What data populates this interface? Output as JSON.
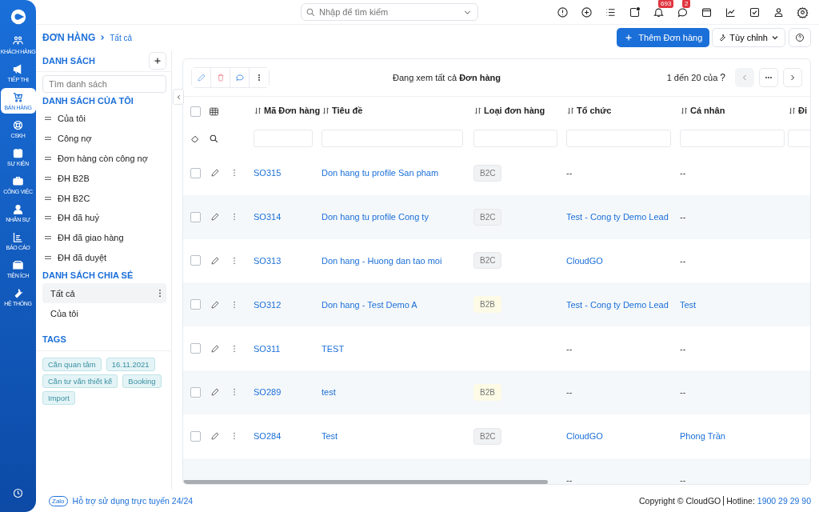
{
  "nav": [
    {
      "label": "KHÁCH HÀNG",
      "selected": false
    },
    {
      "label": "TIẾP THỊ",
      "selected": false
    },
    {
      "label": "BÁN HÀNG",
      "selected": true
    },
    {
      "label": "CSKH",
      "selected": false
    },
    {
      "label": "SỰ KIỆN",
      "selected": false
    },
    {
      "label": "CÔNG VIỆC",
      "selected": false
    },
    {
      "label": "NHÂN SỰ",
      "selected": false
    },
    {
      "label": "BÁO CÁO",
      "selected": false
    },
    {
      "label": "TIỆN ÍCH",
      "selected": false
    },
    {
      "label": "HỆ THỐNG",
      "selected": false
    }
  ],
  "search": {
    "placeholder": "Nhập để tìm kiếm"
  },
  "top_badges": {
    "notifications": "693",
    "messages": "2"
  },
  "breadcrumb": {
    "module": "ĐƠN HÀNG",
    "current": "Tất cả"
  },
  "header_buttons": {
    "add": "Thêm Đơn hàng",
    "customize": "Tùy chỉnh"
  },
  "sidebar": {
    "title": "DANH SÁCH",
    "search_placeholder": "Tìm danh sách",
    "my_lists_title": "DANH SÁCH CỦA TÔI",
    "my_lists": [
      "Của tôi",
      "Công nợ",
      "Đơn hàng còn công nợ",
      "ĐH B2B",
      "ĐH B2C",
      "ĐH đã huỷ",
      "ĐH đã giao hàng",
      "ĐH đã duyệt"
    ],
    "shared_title": "DANH SÁCH CHIA SẺ",
    "shared": [
      {
        "label": "Tất cả",
        "selected": true
      },
      {
        "label": "Của tôi",
        "selected": false
      }
    ],
    "tags_title": "TAGS",
    "tags": [
      "Cần quan tâm",
      "16.11.2021",
      "Cần tư vấn thiết kế",
      "Booking",
      "Import"
    ]
  },
  "table": {
    "select_all_checked": false,
    "viewing": "Đang xem tất cả **Đơn hàng**",
    "paging": "1 đến 20 của",
    "paging_more": "?",
    "columns": [
      "Mã Đơn hàng",
      "Tiêu đề",
      "Loại đơn hàng",
      "Tổ chức",
      "Cá nhân",
      "Đi"
    ],
    "rows": [
      {
        "checked": false,
        "code": "SO315",
        "title": "Don hang tu profile San pham",
        "type": "B2C",
        "org": {
          "text": "--",
          "link": false
        },
        "person": {
          "text": "--",
          "link": false
        }
      },
      {
        "checked": false,
        "code": "SO314",
        "title": "Don hang tu profile Cong ty",
        "type": "B2C",
        "org": {
          "text": "Test - Cong ty Demo Lead",
          "link": true
        },
        "person": {
          "text": "--",
          "link": false
        }
      },
      {
        "checked": false,
        "code": "SO313",
        "title": "Don hang - Huong dan tao moi",
        "type": "B2C",
        "org": {
          "text": "CloudGO",
          "link": true
        },
        "person": {
          "text": "--",
          "link": false
        }
      },
      {
        "checked": false,
        "code": "SO312",
        "title": "Don hang - Test Demo A",
        "type": "B2B",
        "org": {
          "text": "Test - Cong ty Demo Lead",
          "link": true
        },
        "person": {
          "text": "Test",
          "link": true
        }
      },
      {
        "checked": false,
        "code": "SO311",
        "title": "TEST",
        "org": {
          "text": "--",
          "link": false
        },
        "person": {
          "text": "--",
          "link": false
        }
      },
      {
        "checked": false,
        "code": "SO289",
        "title": "test",
        "type": "B2B",
        "org": {
          "text": "--",
          "link": false
        },
        "person": {
          "text": "--",
          "link": false
        }
      },
      {
        "checked": false,
        "code": "SO284",
        "title": "Test",
        "type": "B2C",
        "org": {
          "text": "CloudGO",
          "link": true
        },
        "person": {
          "text": "Phong Trần",
          "link": true
        }
      },
      {
        "org": {
          "text": "--",
          "link": false
        },
        "person": {
          "text": "--",
          "link": false
        }
      }
    ]
  },
  "footer": {
    "support": "Hỗ trợ sử dụng trực tuyến 24/24",
    "zalo": "Zalo",
    "copyright": "Copyright © CloudGO",
    "hotline_label": "Hotline:",
    "hotline": "1900 29 29 90"
  }
}
